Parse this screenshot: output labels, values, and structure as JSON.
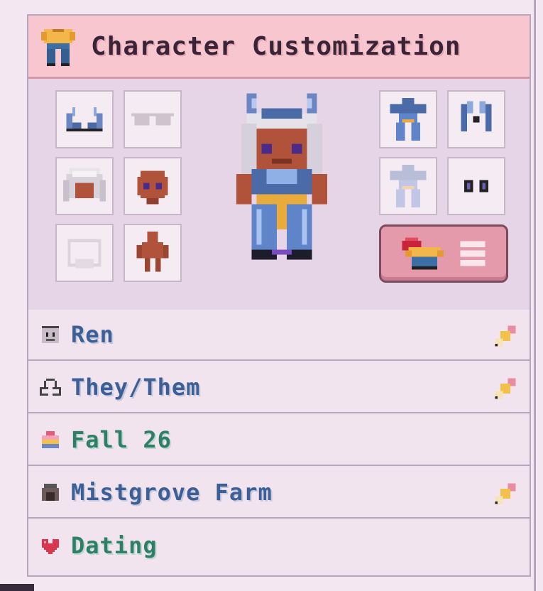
{
  "panel": {
    "title": "Character Customization"
  },
  "slots": {
    "left": [
      {
        "name": "horns-slot",
        "icon": "horns-icon",
        "faded": false
      },
      {
        "name": "glasses-slot",
        "icon": "glasses-icon",
        "faded": true
      },
      {
        "name": "hair-slot",
        "icon": "hair-icon",
        "faded": false
      },
      {
        "name": "skin-slot",
        "icon": "head-icon",
        "faded": false
      },
      {
        "name": "beard-slot",
        "icon": "beard-icon",
        "faded": true
      },
      {
        "name": "body-slot",
        "icon": "body-icon",
        "faded": false
      }
    ],
    "right": [
      {
        "name": "outfit-slot",
        "icon": "outfit-icon",
        "faded": false
      },
      {
        "name": "wings-slot",
        "icon": "wings-icon",
        "faded": false
      },
      {
        "name": "outfit-alt-slot",
        "icon": "outfit-icon",
        "faded": true
      },
      {
        "name": "eyes-slot",
        "icon": "eyes-icon",
        "faded": false
      }
    ],
    "menu_button_icon": "wardrobe-menu-icon"
  },
  "info": {
    "name": "Ren",
    "pronouns": "They/Them",
    "birthday": "Fall 26",
    "farm": "Mistgrove Farm",
    "relationship": "Dating"
  },
  "colors": {
    "title_bg": "#f7c6cf",
    "label_blue": "#3d5f95",
    "label_green": "#2f7f67",
    "accent": "#e59aac"
  }
}
